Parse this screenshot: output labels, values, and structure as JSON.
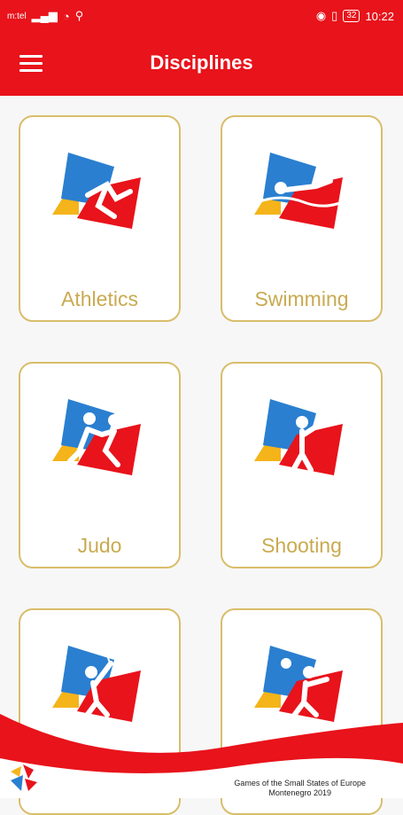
{
  "status": {
    "carrier": "m:tel",
    "battery": "32",
    "time": "10:22"
  },
  "header": {
    "title": "Disciplines"
  },
  "disciplines": [
    {
      "label": "Athletics",
      "icon": "athletics-icon"
    },
    {
      "label": "Swimming",
      "icon": "swimming-icon"
    },
    {
      "label": "Judo",
      "icon": "judo-icon"
    },
    {
      "label": "Shooting",
      "icon": "shooting-icon"
    },
    {
      "label": "",
      "icon": "tennis-icon"
    },
    {
      "label": "",
      "icon": "table-tennis-icon"
    }
  ],
  "footer": {
    "line1": "Games of the Small States of Europe",
    "line2": "Montenegro 2019"
  },
  "colors": {
    "red": "#e8131b",
    "blue": "#2a7fd0",
    "yellow": "#f4b41a",
    "gold": "#d9bd6a"
  }
}
